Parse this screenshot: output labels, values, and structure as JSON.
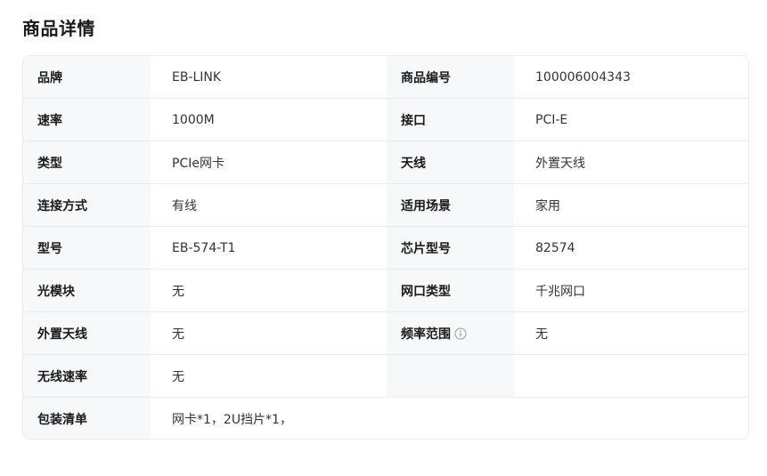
{
  "title": "商品详情",
  "rows": [
    {
      "l1": "品牌",
      "v1": "EB-LINK",
      "l2": "商品编号",
      "v2": "100006004343"
    },
    {
      "l1": "速率",
      "v1": "1000M",
      "l2": "接口",
      "v2": "PCI-E"
    },
    {
      "l1": "类型",
      "v1": "PCIe网卡",
      "l2": "天线",
      "v2": "外置天线"
    },
    {
      "l1": "连接方式",
      "v1": "有线",
      "l2": "适用场景",
      "v2": "家用"
    },
    {
      "l1": "型号",
      "v1": "EB-574-T1",
      "l2": "芯片型号",
      "v2": "82574"
    },
    {
      "l1": "光模块",
      "v1": "无",
      "l2": "网口类型",
      "v2": "千兆网口"
    },
    {
      "l1": "外置天线",
      "v1": "无",
      "l2": "频率范围",
      "v2": "无"
    },
    {
      "l1": "无线速率",
      "v1": "无",
      "l2": "",
      "v2": ""
    }
  ],
  "package": {
    "label": "包装清单",
    "value": "网卡*1，2U挡片*1，"
  },
  "icons": {
    "frequency_info": "info-icon"
  }
}
